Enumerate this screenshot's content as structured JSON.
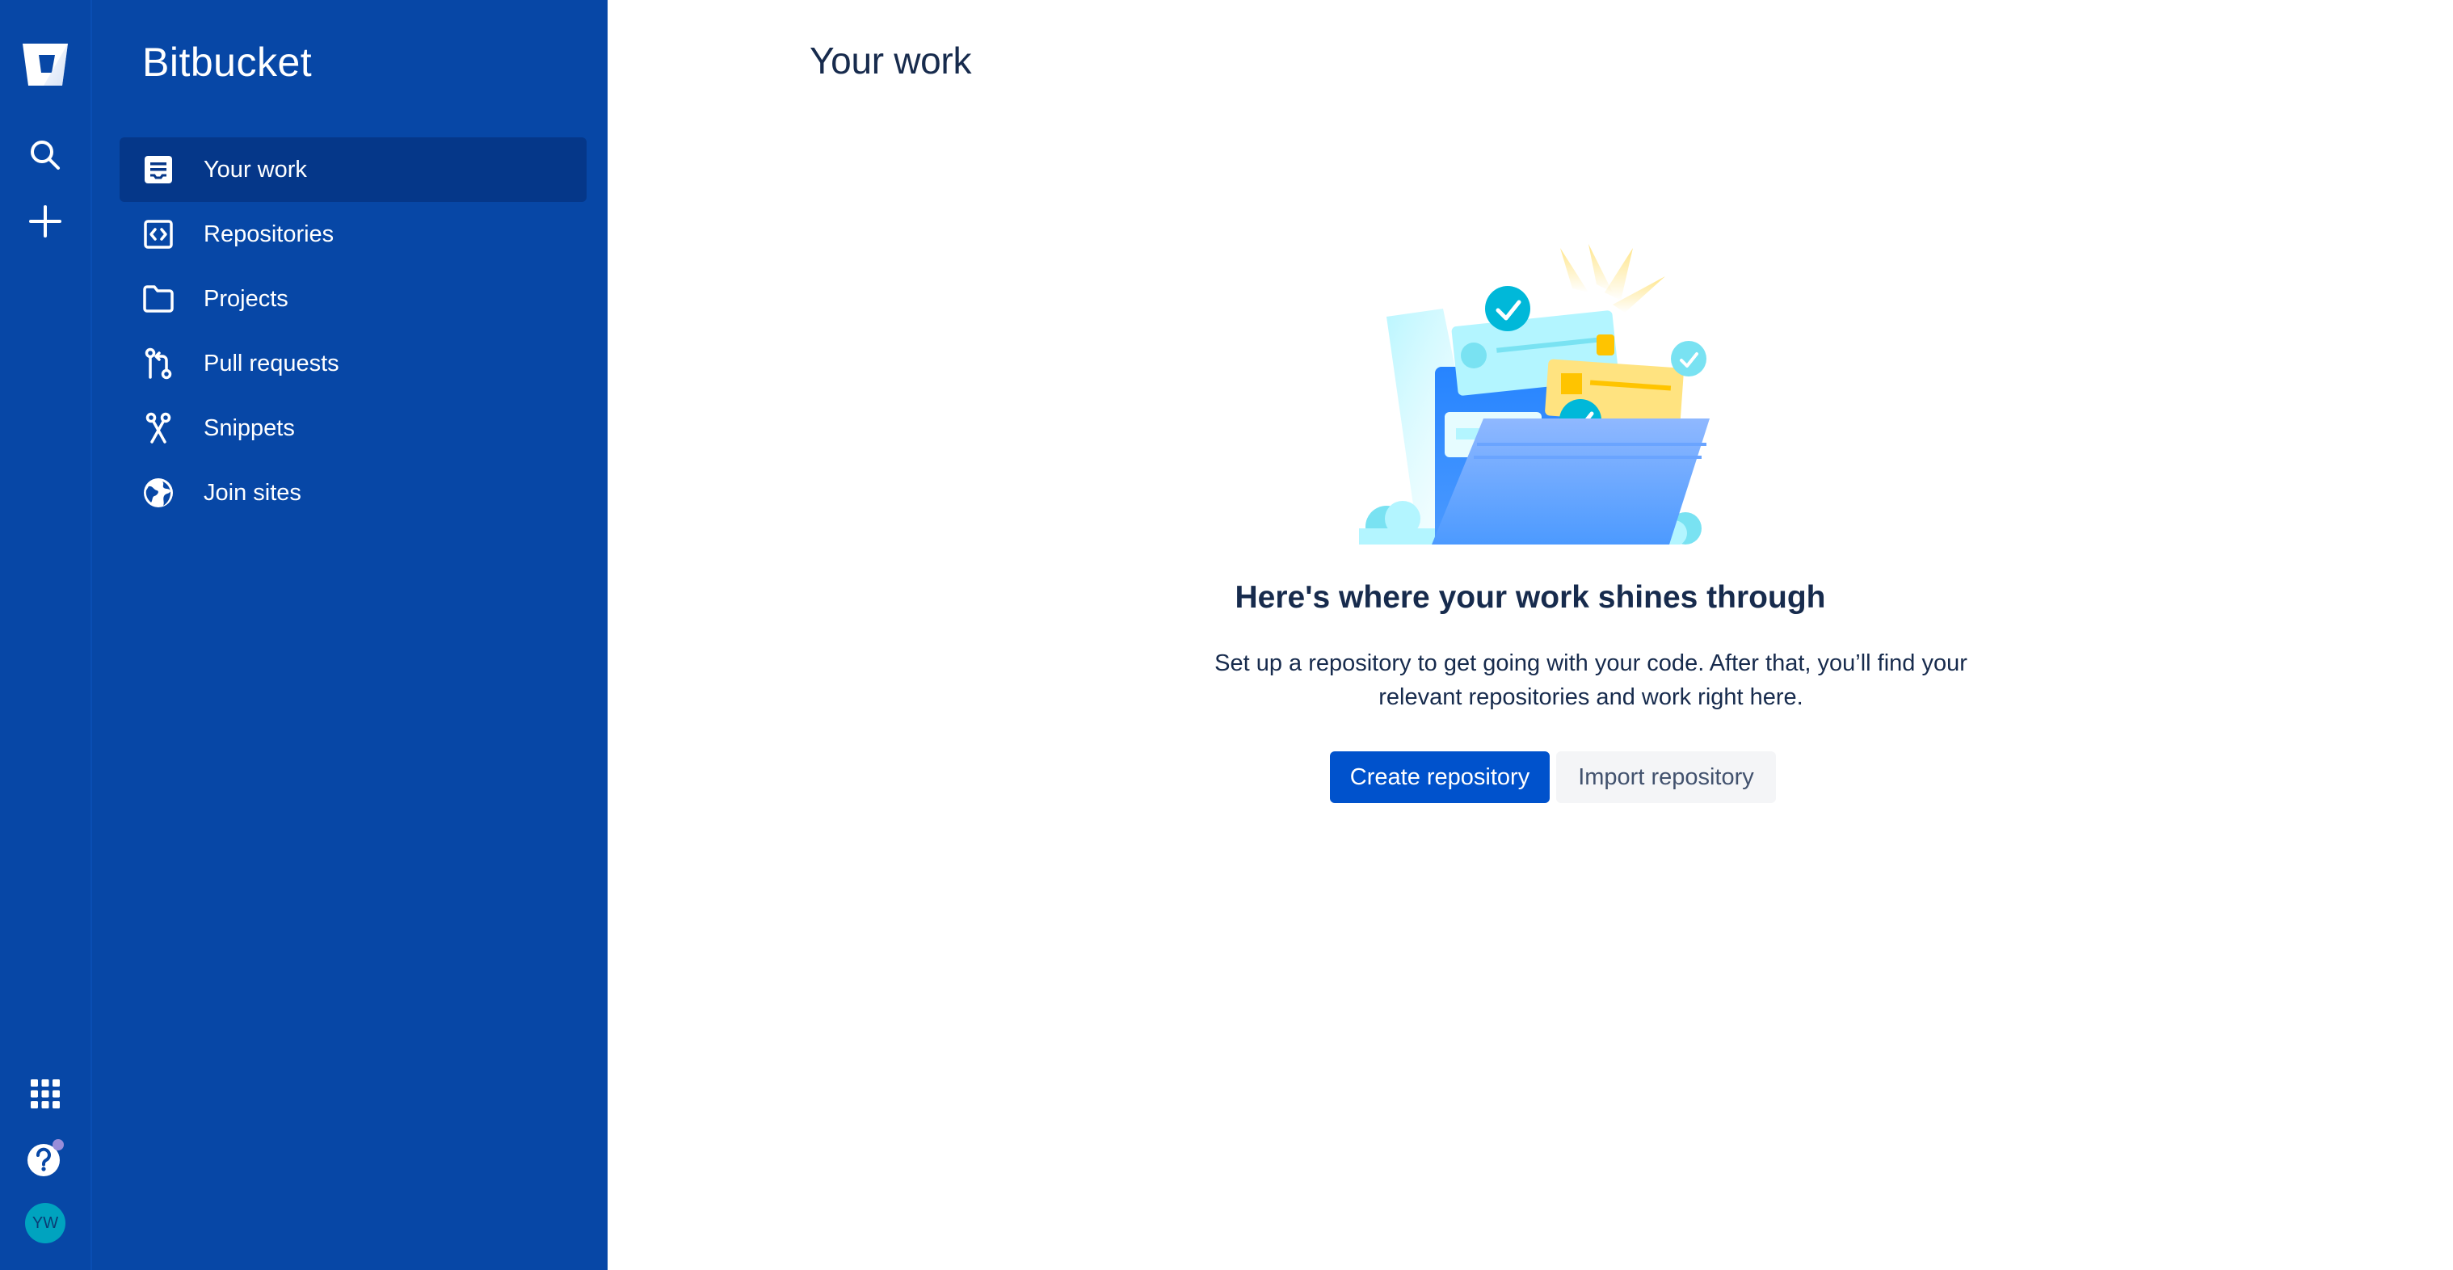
{
  "app": {
    "product_name": "Bitbucket",
    "colors": {
      "sidebar_bg": "#0747a6",
      "active_item_bg": "#053789",
      "primary": "#0052cc",
      "text": "#172b4d"
    }
  },
  "rail": {
    "icons": [
      "bitbucket-logo",
      "search-icon",
      "create-icon",
      "app-switcher-icon",
      "help-icon",
      "avatar"
    ],
    "avatar_initials": "YW"
  },
  "sidebar": {
    "items": [
      {
        "label": "Your work",
        "icon": "your-work-icon",
        "active": true
      },
      {
        "label": "Repositories",
        "icon": "repositories-icon",
        "active": false
      },
      {
        "label": "Projects",
        "icon": "folder-icon",
        "active": false
      },
      {
        "label": "Pull requests",
        "icon": "pull-request-icon",
        "active": false
      },
      {
        "label": "Snippets",
        "icon": "scissors-icon",
        "active": false
      },
      {
        "label": "Join sites",
        "icon": "globe-icon",
        "active": false
      }
    ]
  },
  "main": {
    "title": "Your work",
    "empty_state": {
      "heading": "Here's where your work shines through",
      "text": "Set up a repository to get going with your code. After that, you’ll find your relevant repositories and work right here.",
      "primary_button": "Create repository",
      "secondary_button": "Import repository"
    }
  }
}
